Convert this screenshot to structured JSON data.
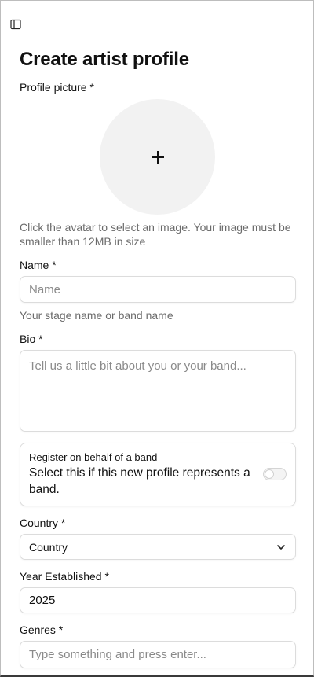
{
  "header": {
    "sidebar_toggle_icon": "sidebar-panel-icon"
  },
  "page": {
    "title": "Create artist profile"
  },
  "profile_picture": {
    "label": "Profile picture *",
    "add_icon": "plus-icon",
    "help": "Click the avatar to select an image. Your image must be smaller than 12MB in size"
  },
  "name": {
    "label": "Name *",
    "placeholder": "Name",
    "value": "",
    "help": "Your stage name or band name"
  },
  "bio": {
    "label": "Bio *",
    "placeholder": "Tell us a little bit about you or your band...",
    "value": ""
  },
  "band_option": {
    "title": "Register on behalf of a band",
    "description": "Select this if this new profile represents a band.",
    "enabled": false
  },
  "country": {
    "label": "Country *",
    "selected": "Country",
    "chevron_icon": "chevron-down-icon"
  },
  "year": {
    "label": "Year Established *",
    "value": "2025"
  },
  "genres": {
    "label": "Genres *",
    "placeholder": "Type something and press enter...",
    "value": ""
  },
  "colors": {
    "avatar_bg": "#f2f2f2",
    "border": "#dcdcdc",
    "help_text": "#6b6b6b"
  }
}
